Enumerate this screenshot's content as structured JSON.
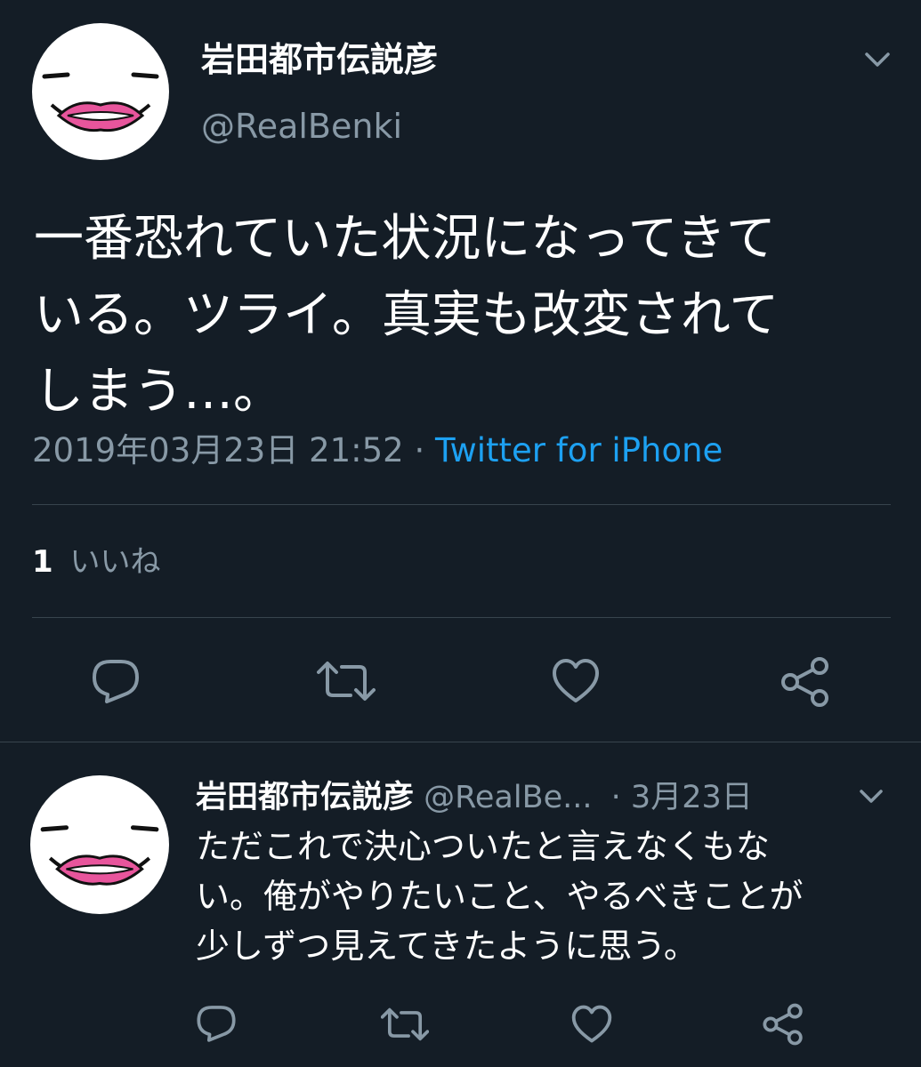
{
  "main_tweet": {
    "display_name": "岩田都市伝説彦",
    "handle": "@RealBenki",
    "text_lines": [
      "一番恐れていた状況になってきて",
      "いる。ツライ。真実も改変されて",
      "しまう…。"
    ],
    "timestamp": "2019年03月23日 21:52",
    "separator": " · ",
    "source": "Twitter for iPhone",
    "like_count": "1",
    "like_label": "いいね"
  },
  "reply_tweet": {
    "display_name": "岩田都市伝説彦",
    "handle": "@RealBe...",
    "date": "· 3月23日",
    "text_lines": [
      "ただこれで決心ついたと言えなくもな",
      "い。俺がやりたいこと、やるべきことが",
      "少しずつ見えてきたように思う。"
    ]
  },
  "icons": {
    "reply": "reply-icon",
    "retweet": "retweet-icon",
    "like": "heart-icon",
    "share": "share-icon",
    "menu": "chevron-down-icon"
  },
  "colors": {
    "background": "#141d26",
    "text_primary": "#ffffff",
    "text_secondary": "#8899a6",
    "accent": "#1da1f2",
    "divider": "#38444d",
    "avatar_lips": "#e8559c"
  }
}
